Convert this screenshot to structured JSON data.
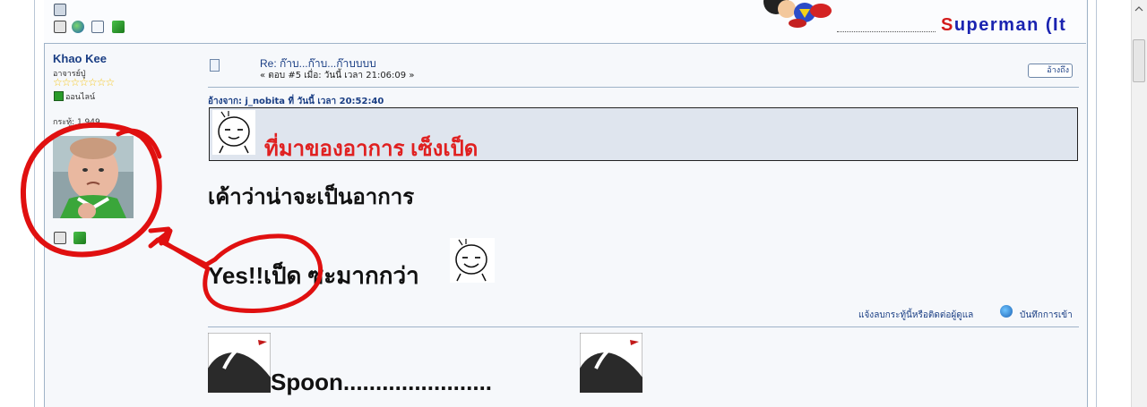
{
  "signature_header": {
    "name_first_letter": "S",
    "name_rest": "uperman (It"
  },
  "poster": {
    "name": "Khao Kee",
    "title": "อาจารย์ปู่",
    "stars": "☆☆☆☆☆☆☆",
    "status": "ออนไลน์",
    "posts": "กระทู้: 1,949"
  },
  "message": {
    "title": "Re: ก๊าบ...ก๊าบ...ก๊าบบบบ",
    "meta": "« ตอบ #5 เมื่อ: วันนี้ เวลา 21:06:09 »",
    "quote_button": "อ้างถึง",
    "quote_header": "อ้างจาก: j_nobita ที่ วันนี้ เวลา 20:52:40",
    "quote_text": "ที่มาของอาการ เซ็งเป็ด",
    "body_line1": "เค้าว่าน่าจะเป็นอาการ",
    "body_line2": "Yes!!เป็ด ซะมากกว่า",
    "report_link": "แจ้งลบกระทู้นี้หรือติดต่อผู้ดูแล",
    "ip_link": "บันทึกการเข้า"
  },
  "signature": {
    "text": "Spoon......................."
  },
  "icons": [
    "profile-icon",
    "website-icon",
    "pm-icon",
    "msn-icon",
    "globe-icon",
    "document-icon"
  ],
  "colors": {
    "link": "#1a3e84",
    "quote_text": "#e02020",
    "annotation": "#e01010"
  }
}
